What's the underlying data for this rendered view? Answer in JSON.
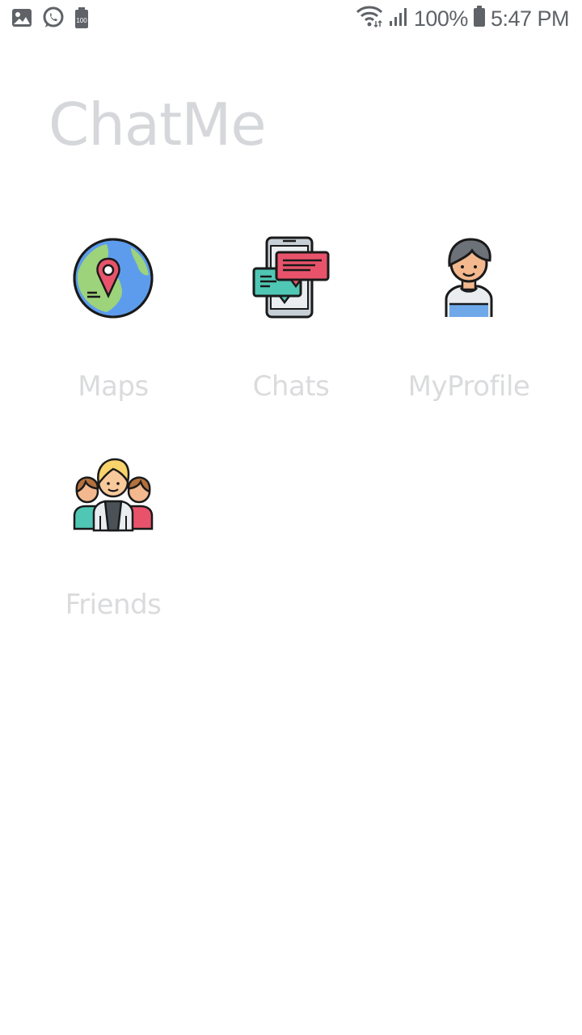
{
  "status_bar": {
    "battery_percent": "100%",
    "time": "5:47 PM",
    "battery_small_label": "100",
    "left_icons": [
      "image-icon",
      "whatsapp-icon",
      "battery-saver-icon"
    ],
    "right_icons": [
      "wifi-icon",
      "signal-icon",
      "battery-icon"
    ]
  },
  "app": {
    "title": "ChatMe"
  },
  "menu": {
    "items": [
      {
        "label": "Maps",
        "icon": "globe-location-icon"
      },
      {
        "label": "Chats",
        "icon": "phone-chat-icon"
      },
      {
        "label": "MyProfile",
        "icon": "user-avatar-icon"
      },
      {
        "label": "Friends",
        "icon": "group-people-icon"
      }
    ]
  },
  "colors": {
    "title": "#d6d7db",
    "label": "#dadbdd",
    "status_text": "#5f6368"
  }
}
